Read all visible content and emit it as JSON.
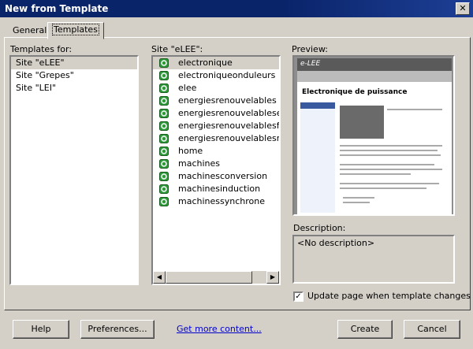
{
  "window": {
    "title": "New from Template"
  },
  "tabs": [
    {
      "label": "General"
    },
    {
      "label": "Templates"
    }
  ],
  "templates_for": {
    "label": "Templates for:",
    "items": [
      "Site \"eLEE\"",
      "Site \"Grepes\"",
      "Site \"LEI\""
    ],
    "selected": "Site \"eLEE\""
  },
  "site_list": {
    "label": "Site \"eLEE\":",
    "items": [
      "electronique",
      "electroniqueonduleurs",
      "elee",
      "energiesrenouvelables",
      "energiesrenouvelablesenje",
      "energiesrenouvelablesfilier",
      "energiesrenouvelablesmise",
      "home",
      "machines",
      "machinesconversion",
      "machinesinduction",
      "machinessynchrone"
    ],
    "selected": "electronique"
  },
  "preview": {
    "label": "Preview:",
    "page_heading": "Electronique de puissance",
    "logo_text": "e-LEE"
  },
  "description": {
    "label": "Description:",
    "value": "<No description>"
  },
  "update_checkbox": {
    "label": "Update page when template changes",
    "checked": true
  },
  "buttons": {
    "help": "Help",
    "preferences": "Preferences...",
    "get_more": "Get more content...",
    "create": "Create",
    "cancel": "Cancel"
  },
  "icons": {
    "close": "close-icon",
    "template": "dreamweaver-template-icon",
    "scroll_left": "arrow-left-icon",
    "scroll_right": "arrow-right-icon",
    "checkmark": "checkmark-icon"
  }
}
